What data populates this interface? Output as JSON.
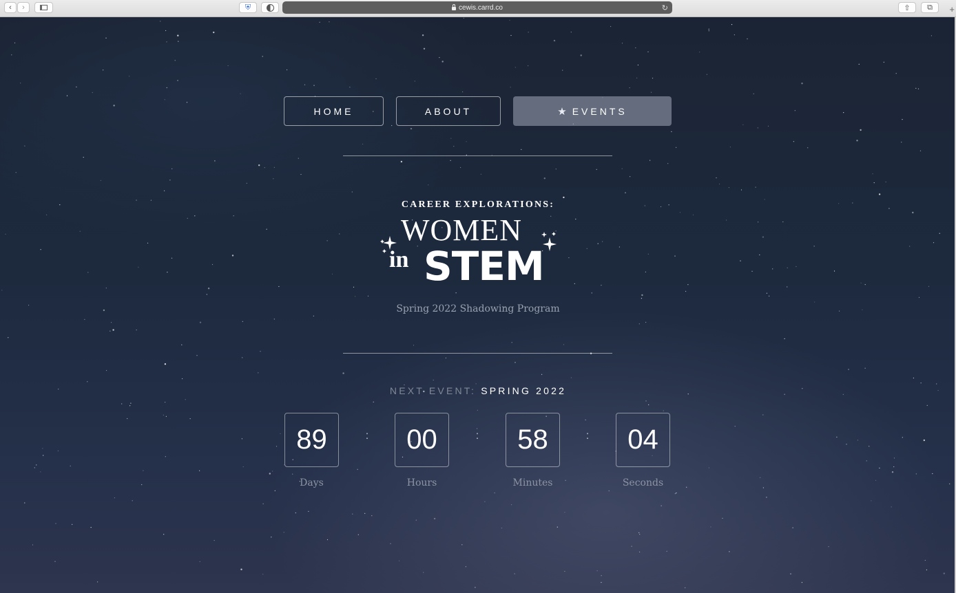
{
  "browser": {
    "url": "cewis.carrd.co",
    "icons": [
      "back-icon",
      "forward-icon",
      "sidebar-icon",
      "shield-icon",
      "privacy-icon",
      "lock-icon",
      "reload-icon",
      "share-icon",
      "tabs-icon",
      "new-tab-icon"
    ]
  },
  "nav": {
    "home": "HOME",
    "about": "ABOUT",
    "events": "EVENTS",
    "active_icon": "star-icon"
  },
  "hero": {
    "tagline": "CAREER EXPLORATIONS:",
    "logo_line1": "WOMEN",
    "logo_in": "in",
    "logo_line2": "STEM",
    "subtitle": "Spring 2022 Shadowing Program"
  },
  "countdown": {
    "prefix": "NEXT EVENT:",
    "event": "SPRING 2022",
    "days": "89",
    "hours": "00",
    "minutes": "58",
    "seconds": "04",
    "days_label": "Days",
    "hours_label": "Hours",
    "minutes_label": "Minutes",
    "seconds_label": "Seconds",
    "separator": ":"
  },
  "colors": {
    "background": "#1d2a3e",
    "text": "#ffffff",
    "muted": "#8c93a3",
    "active_button": "#8a909e"
  }
}
